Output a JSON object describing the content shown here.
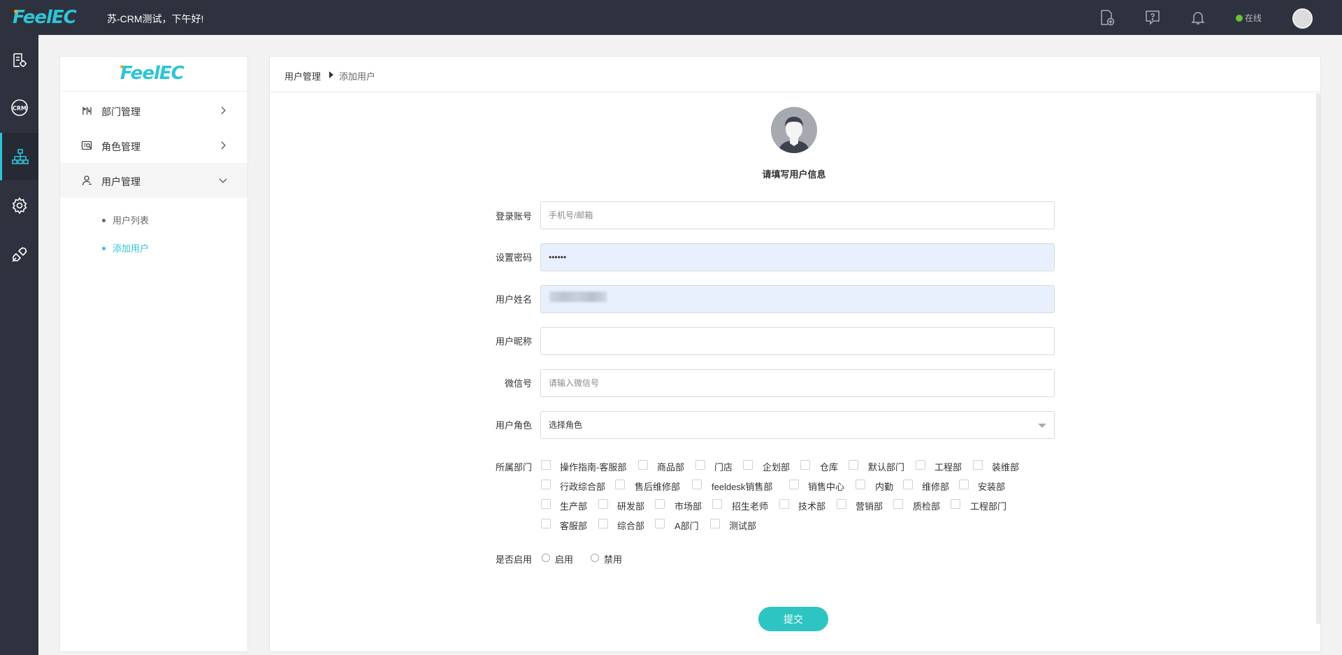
{
  "header": {
    "logo": "FeelEC",
    "greeting": "苏-CRM测试，下午好!",
    "status": "在线",
    "icons": [
      "add-document-icon",
      "help-icon",
      "bell-icon"
    ]
  },
  "leftnav": {
    "items": [
      "report-icon",
      "crm-icon",
      "org-chart-icon",
      "settings-icon",
      "plugin-icon"
    ],
    "active_index": 2
  },
  "sidebar": {
    "logo": "FeelEC",
    "menus": [
      {
        "label": "部门管理",
        "icon": "department-icon",
        "expanded": false
      },
      {
        "label": "角色管理",
        "icon": "role-icon",
        "expanded": false
      },
      {
        "label": "用户管理",
        "icon": "user-icon",
        "expanded": true
      }
    ],
    "submenu": [
      {
        "label": "用户列表",
        "active": false
      },
      {
        "label": "添加用户",
        "active": true
      }
    ]
  },
  "breadcrumb": {
    "parent": "用户管理",
    "current": "添加用户"
  },
  "form": {
    "title": "请填写用户信息",
    "account": {
      "label": "登录账号",
      "placeholder": "手机号/邮箱",
      "value": ""
    },
    "password": {
      "label": "设置密码",
      "value": "••••••"
    },
    "name": {
      "label": "用户姓名",
      "value": ""
    },
    "nickname": {
      "label": "用户昵称",
      "value": ""
    },
    "wechat": {
      "label": "微信号",
      "placeholder": "请输入微信号",
      "value": ""
    },
    "role": {
      "label": "用户角色",
      "selected": "选择角色"
    },
    "departments": {
      "label": "所属部门",
      "rows": [
        [
          "操作指南-客服部",
          "商品部",
          "门店",
          "企划部",
          "仓库",
          "默认部门",
          "工程部",
          "装维部"
        ],
        [
          "行政综合部",
          "售后维修部",
          "feeldesk销售部",
          "销售中心",
          "内勤",
          "维修部",
          "安装部"
        ],
        [
          "生产部",
          "研发部",
          "市场部",
          "招生老师",
          "技术部",
          "营销部",
          "质检部",
          "工程部门"
        ],
        [
          "客服部",
          "综合部",
          "A部门",
          "测试部"
        ]
      ]
    },
    "enabled": {
      "label": "是否启用",
      "options": [
        "启用",
        "禁用"
      ],
      "selected": null
    },
    "submit_label": "提交"
  },
  "colors": {
    "accent": "#2ec4d6",
    "topbar": "#2e323e",
    "submit": "#2ec4c2",
    "online": "#67c23a"
  }
}
